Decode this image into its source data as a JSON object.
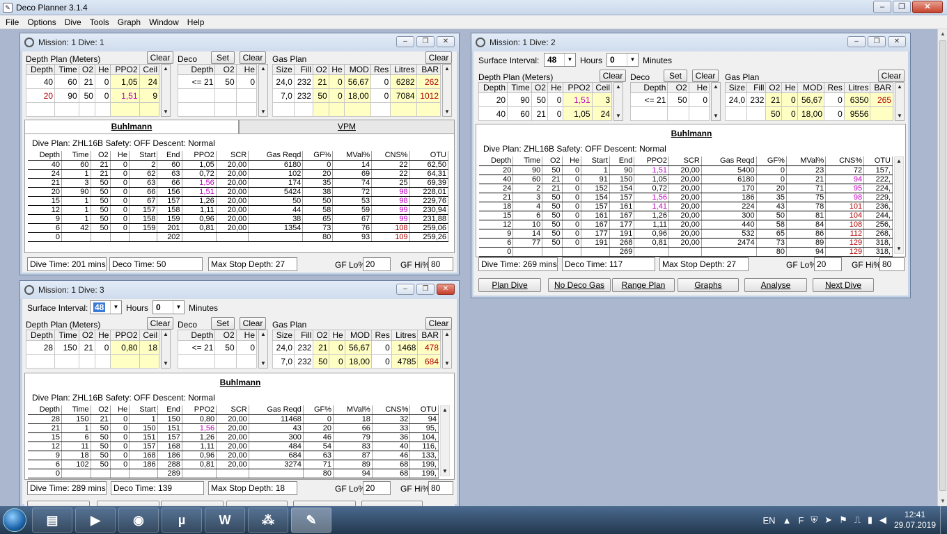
{
  "app": {
    "title": "Deco Planner 3.1.4"
  },
  "menu": [
    "File",
    "Options",
    "Dive",
    "Tools",
    "Graph",
    "Window",
    "Help"
  ],
  "labels": {
    "depth_plan": "Depth Plan (Meters)",
    "deco": "Deco",
    "gas_plan": "Gas Plan",
    "clear": "Clear",
    "set": "Set",
    "surface_interval": "Surface Interval:",
    "hours": "Hours",
    "minutes": "Minutes",
    "gf_lo": "GF Lo%:",
    "gf_hi": "GF Hi%:",
    "dive_time_prefix": "Dive Time:",
    "deco_time_prefix": "Deco Time:",
    "max_stop_prefix": "Max Stop Depth:"
  },
  "hdr": {
    "depth": [
      "Depth",
      "Time",
      "O2",
      "He",
      "PPO2",
      "Ceil"
    ],
    "deco": [
      "Depth",
      "O2",
      "He"
    ],
    "gas": [
      "Size",
      "Fill",
      "O2",
      "He",
      "MOD",
      "Res",
      "Litres",
      "BAR"
    ],
    "results": [
      "Depth",
      "Time",
      "O2",
      "He",
      "Start",
      "End",
      "PPO2",
      "SCR",
      "Gas Reqd",
      "GF%",
      "MVal%",
      "CNS%",
      "OTU"
    ]
  },
  "dive1": {
    "title": "Mission: 1 Dive: 1",
    "depth_rows": [
      [
        "40",
        "60",
        "21",
        "0",
        "1,05",
        "24"
      ],
      [
        "20",
        "90",
        "50",
        "0",
        "1,51",
        "9"
      ]
    ],
    "deco_rows": [
      [
        "<= 21",
        "50",
        "0"
      ]
    ],
    "gas_rows": [
      [
        "24,0",
        "232",
        "21",
        "0",
        "56,67",
        "0",
        "6282",
        "262"
      ],
      [
        "7,0",
        "232",
        "50",
        "0",
        "18,00",
        "0",
        "7084",
        "1012"
      ]
    ],
    "tabs": [
      "Buhlmann",
      "VPM"
    ],
    "plan_line": "Dive Plan: ZHL16B   Safety: OFF  Descent: Normal",
    "results": [
      [
        "40",
        "60",
        "21",
        "0",
        "2",
        "60",
        "1,05",
        "20,00",
        "6180",
        "0",
        "14",
        "22",
        "62,50"
      ],
      [
        "24",
        "1",
        "21",
        "0",
        "62",
        "63",
        "0,72",
        "20,00",
        "102",
        "20",
        "69",
        "22",
        "64,31"
      ],
      [
        "21",
        "3",
        "50",
        "0",
        "63",
        "66",
        "1,56",
        "20,00",
        "174",
        "35",
        "74",
        "25",
        "69,39"
      ],
      [
        "20",
        "90",
        "50",
        "0",
        "66",
        "156",
        "1,51",
        "20,00",
        "5424",
        "38",
        "72",
        "98",
        "228,01"
      ],
      [
        "15",
        "1",
        "50",
        "0",
        "67",
        "157",
        "1,26",
        "20,00",
        "50",
        "50",
        "53",
        "98",
        "229,76"
      ],
      [
        "12",
        "1",
        "50",
        "0",
        "157",
        "158",
        "1,11",
        "20,00",
        "44",
        "58",
        "59",
        "99",
        "230,94"
      ],
      [
        "9",
        "1",
        "50",
        "0",
        "158",
        "159",
        "0,96",
        "20,00",
        "38",
        "65",
        "67",
        "99",
        "231,88"
      ],
      [
        "6",
        "42",
        "50",
        "0",
        "159",
        "201",
        "0,81",
        "20,00",
        "1354",
        "73",
        "76",
        "108",
        "259,06"
      ],
      [
        "0",
        "",
        "",
        "",
        "",
        "202",
        "",
        "",
        "",
        "80",
        "93",
        "109",
        "259,26"
      ]
    ],
    "dive_time": "Dive Time: 201 mins",
    "deco_time": "Deco Time: 50",
    "max_stop": "Max Stop Depth: 27",
    "gf_lo": "20",
    "gf_hi": "80"
  },
  "dive2": {
    "title": "Mission: 1 Dive: 2",
    "si_hours": "48",
    "si_minutes": "0",
    "depth_rows": [
      [
        "20",
        "90",
        "50",
        "0",
        "1,51",
        "3"
      ],
      [
        "40",
        "60",
        "21",
        "0",
        "1,05",
        "24"
      ]
    ],
    "deco_rows": [
      [
        "<= 21",
        "50",
        "0"
      ]
    ],
    "gas_rows": [
      [
        "24,0",
        "232",
        "21",
        "0",
        "56,67",
        "0",
        "6350",
        "265"
      ],
      [
        "",
        "",
        "50",
        "0",
        "18,00",
        "0",
        "9556",
        ""
      ]
    ],
    "tab": "Buhlmann",
    "plan_line": "Dive Plan: ZHL16B   Safety: OFF  Descent: Normal",
    "results": [
      [
        "20",
        "90",
        "50",
        "0",
        "1",
        "90",
        "1,51",
        "20,00",
        "5400",
        "0",
        "23",
        "72",
        "157,"
      ],
      [
        "40",
        "60",
        "21",
        "0",
        "91",
        "150",
        "1,05",
        "20,00",
        "6180",
        "0",
        "21",
        "94",
        "222,"
      ],
      [
        "24",
        "2",
        "21",
        "0",
        "152",
        "154",
        "0,72",
        "20,00",
        "170",
        "20",
        "71",
        "95",
        "224,"
      ],
      [
        "21",
        "3",
        "50",
        "0",
        "154",
        "157",
        "1,56",
        "20,00",
        "186",
        "35",
        "75",
        "98",
        "229,"
      ],
      [
        "18",
        "4",
        "50",
        "0",
        "157",
        "161",
        "1,41",
        "20,00",
        "224",
        "43",
        "78",
        "101",
        "236,"
      ],
      [
        "15",
        "6",
        "50",
        "0",
        "161",
        "167",
        "1,26",
        "20,00",
        "300",
        "50",
        "81",
        "104",
        "244,"
      ],
      [
        "12",
        "10",
        "50",
        "0",
        "167",
        "177",
        "1,11",
        "20,00",
        "440",
        "58",
        "84",
        "108",
        "256,"
      ],
      [
        "9",
        "14",
        "50",
        "0",
        "177",
        "191",
        "0,96",
        "20,00",
        "532",
        "65",
        "86",
        "112",
        "268,"
      ],
      [
        "6",
        "77",
        "50",
        "0",
        "191",
        "268",
        "0,81",
        "20,00",
        "2474",
        "73",
        "89",
        "129",
        "318,"
      ],
      [
        "0",
        "",
        "",
        "",
        "",
        "269",
        "",
        "",
        "",
        "80",
        "94",
        "129",
        "318,"
      ]
    ],
    "dive_time": "Dive Time: 269 mins",
    "deco_time": "Deco Time: 117",
    "max_stop": "Max Stop Depth: 27",
    "gf_lo": "20",
    "gf_hi": "80",
    "buttons": [
      "Plan Dive",
      "No Deco Gas",
      "Range Plan",
      "Graphs",
      "Analyse",
      "Next Dive"
    ]
  },
  "dive3": {
    "title": "Mission: 1 Dive: 3",
    "si_hours": "48",
    "si_minutes": "0",
    "depth_rows": [
      [
        "28",
        "150",
        "21",
        "0",
        "0,80",
        "18"
      ]
    ],
    "deco_rows": [
      [
        "<= 21",
        "50",
        "0"
      ]
    ],
    "gas_rows": [
      [
        "24,0",
        "232",
        "21",
        "0",
        "56,67",
        "0",
        "1468",
        "478"
      ],
      [
        "7,0",
        "232",
        "50",
        "0",
        "18,00",
        "0",
        "4785",
        "684"
      ]
    ],
    "tab": "Buhlmann",
    "plan_line": "Dive Plan: ZHL16B   Safety: OFF  Descent: Normal",
    "results": [
      [
        "28",
        "150",
        "21",
        "0",
        "1",
        "150",
        "0,80",
        "20,00",
        "11468",
        "0",
        "18",
        "32",
        "94"
      ],
      [
        "21",
        "1",
        "50",
        "0",
        "150",
        "151",
        "1,56",
        "20,00",
        "43",
        "20",
        "66",
        "33",
        "95,"
      ],
      [
        "15",
        "6",
        "50",
        "0",
        "151",
        "157",
        "1,26",
        "20,00",
        "300",
        "46",
        "79",
        "36",
        "104,"
      ],
      [
        "12",
        "11",
        "50",
        "0",
        "157",
        "168",
        "1,11",
        "20,00",
        "484",
        "54",
        "83",
        "40",
        "116,"
      ],
      [
        "9",
        "18",
        "50",
        "0",
        "168",
        "186",
        "0,96",
        "20,00",
        "684",
        "63",
        "87",
        "46",
        "133,"
      ],
      [
        "6",
        "102",
        "50",
        "0",
        "186",
        "288",
        "0,81",
        "20,00",
        "3274",
        "71",
        "89",
        "68",
        "199,"
      ],
      [
        "0",
        "",
        "",
        "",
        "",
        "289",
        "",
        "",
        "",
        "80",
        "94",
        "68",
        "199,"
      ]
    ],
    "dive_time": "Dive Time: 289 mins",
    "deco_time": "Deco Time: 139",
    "max_stop": "Max Stop Depth: 18",
    "gf_lo": "20",
    "gf_hi": "80"
  },
  "taskbar": {
    "apps": [
      "explorer-icon",
      "media-player-icon",
      "firefox-icon",
      "utorrent-icon",
      "word-icon",
      "pdf-icon",
      "deco-planner-icon"
    ],
    "app_glyphs": [
      "▤",
      "▶",
      "◉",
      "µ",
      "W",
      "⁂",
      "✎"
    ],
    "lang": "EN",
    "time": "12:41",
    "date": "29.07.2019"
  },
  "colors": {
    "yellow_cell": "#ffffc4",
    "magenta": "#c000c0",
    "red": "#b00000"
  }
}
